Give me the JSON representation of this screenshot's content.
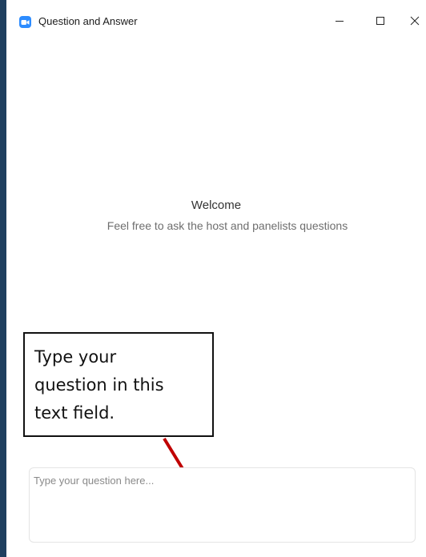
{
  "window": {
    "title": "Question and Answer",
    "app_icon": "zoom-camera-icon",
    "controls": {
      "minimize_icon": "minimize-icon",
      "maximize_icon": "maximize-icon",
      "close_icon": "close-icon"
    }
  },
  "main": {
    "welcome_title": "Welcome",
    "welcome_subtitle": "Feel free to ask the host and panelists questions"
  },
  "annotation": {
    "callout_lines": [
      "Type your",
      "question in this",
      "text field."
    ],
    "arrow_color": "#c00000"
  },
  "composer": {
    "placeholder": "Type your question here...",
    "value": ""
  },
  "colors": {
    "accent": "#2d8cff",
    "window_border": "#1f3f5f"
  }
}
